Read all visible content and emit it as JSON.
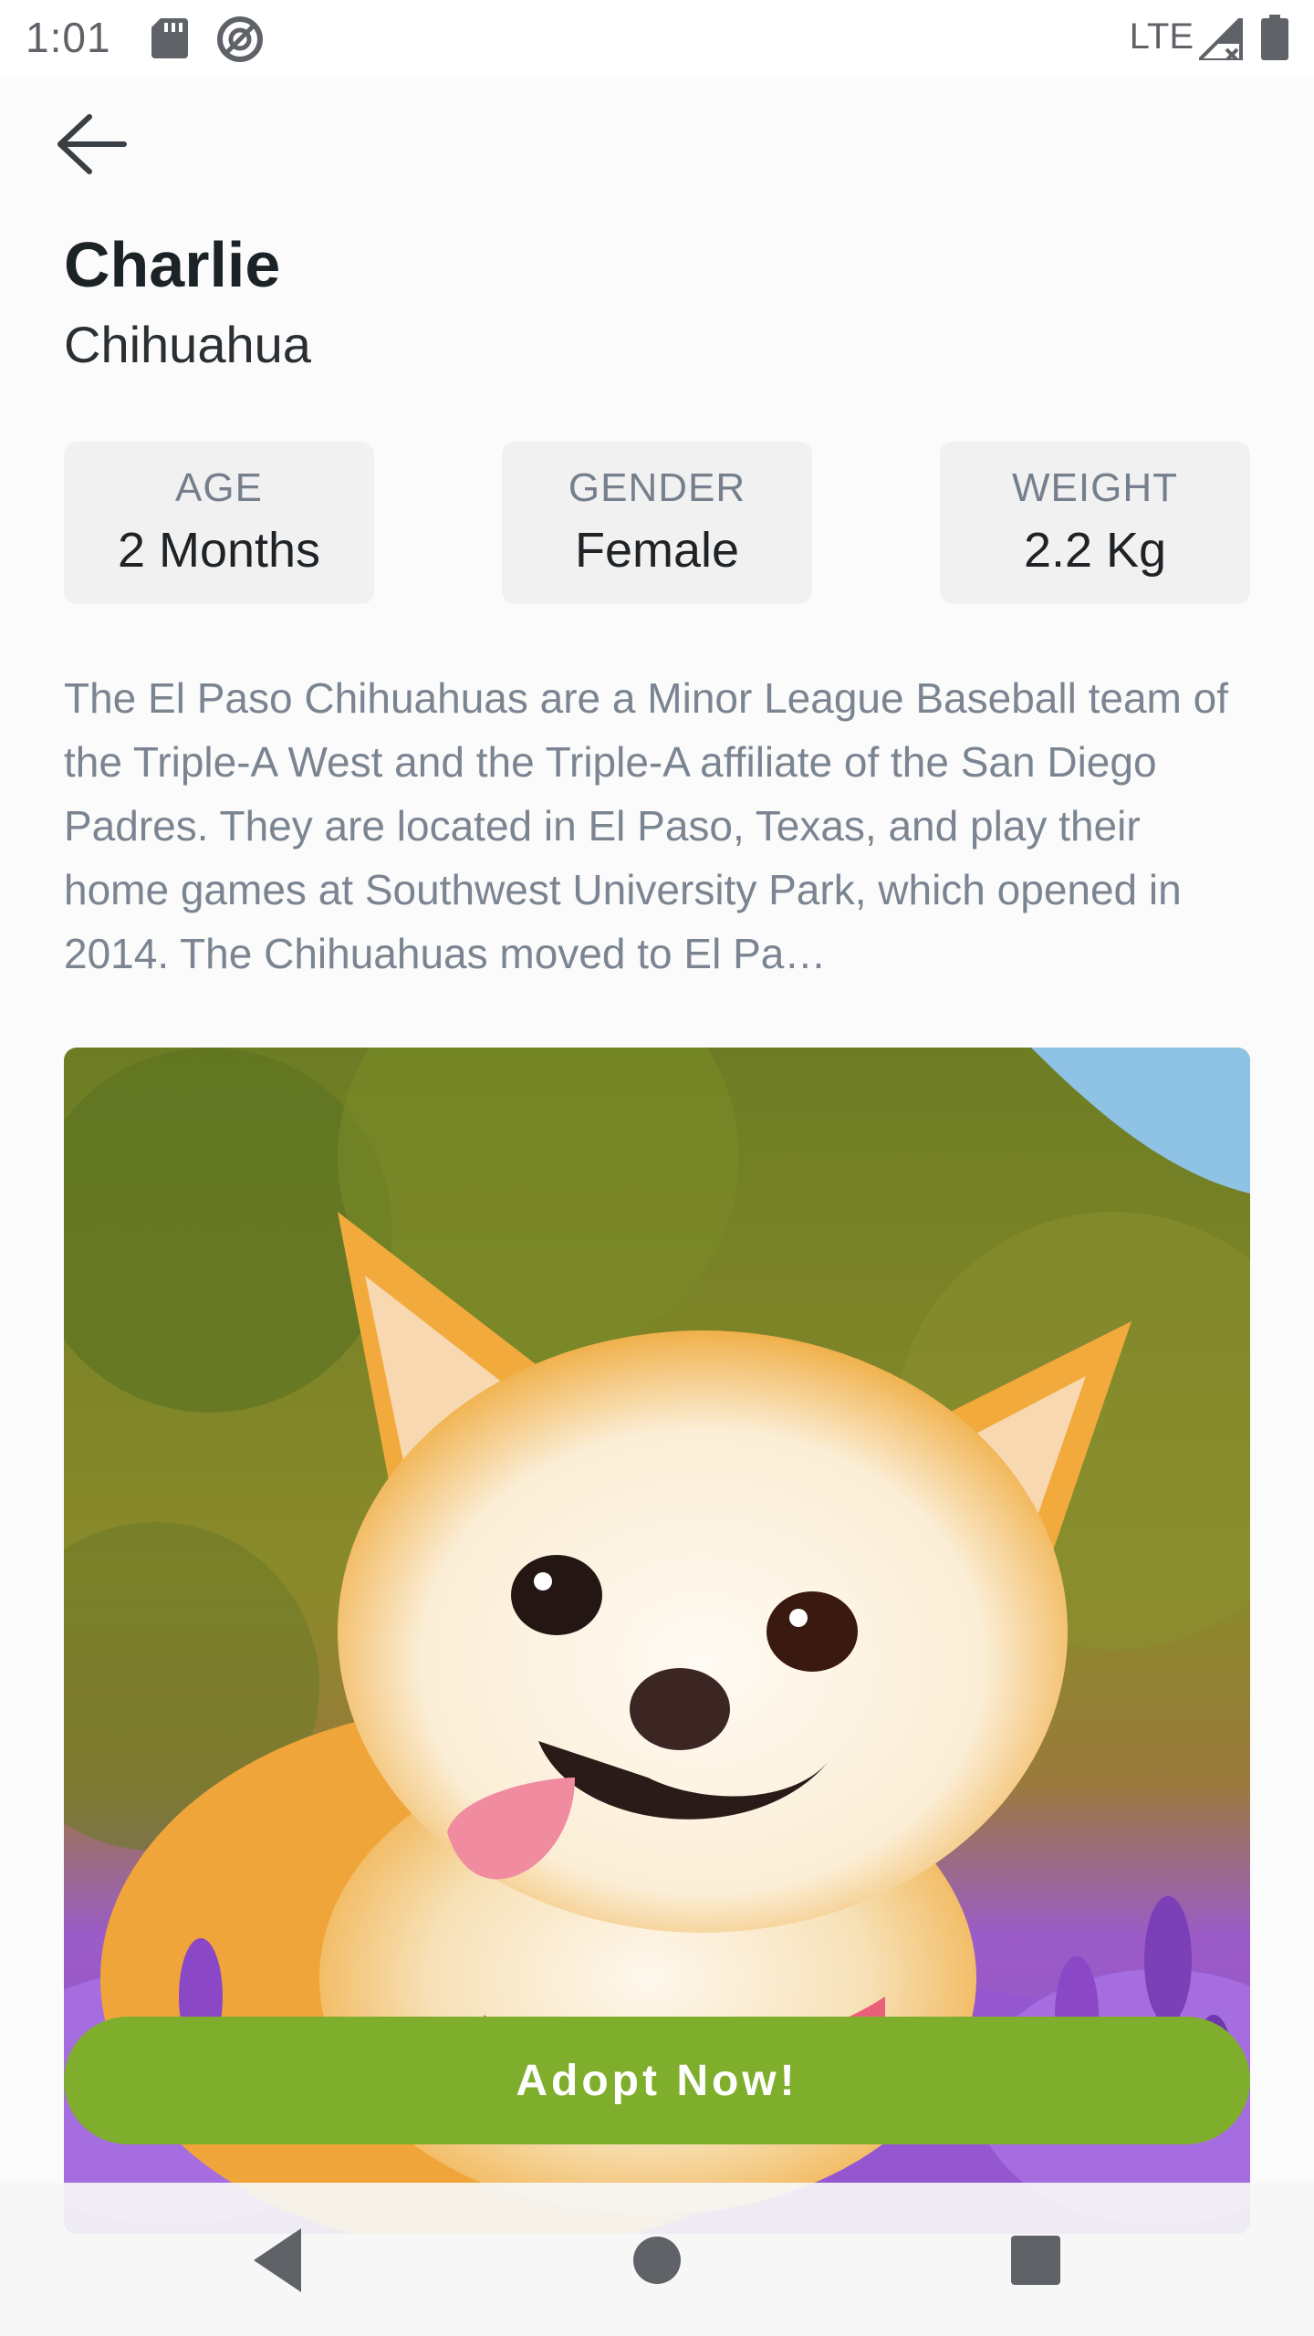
{
  "status_bar": {
    "time": "1:01",
    "network": "LTE",
    "icons": [
      "sd-card-icon",
      "no-disturb-icon",
      "signal-icon",
      "battery-icon"
    ]
  },
  "header": {
    "back_icon": "arrow-back-icon"
  },
  "pet": {
    "name": "Charlie",
    "breed": "Chihuahua",
    "stats": [
      {
        "label": "AGE",
        "value": "2 Months"
      },
      {
        "label": "GENDER",
        "value": "Female"
      },
      {
        "label": "WEIGHT",
        "value": "2.2 Kg"
      }
    ],
    "description": "The El Paso Chihuahuas are a Minor League Baseball team of the Triple-A West and the Triple-A affiliate of the San Diego Padres. They are located in El Paso, Texas, and play their home games at Southwest University Park, which opened in 2014. The Chihuahuas moved to El Pa…"
  },
  "actions": {
    "adopt_label": "Adopt Now!"
  },
  "colors": {
    "accent": "#7fae2d",
    "card_bg": "#f1f1f2",
    "label": "#76808c",
    "description": "#7b8591"
  },
  "nav": {
    "icons": [
      "nav-back-icon",
      "nav-home-icon",
      "nav-recents-icon"
    ]
  }
}
